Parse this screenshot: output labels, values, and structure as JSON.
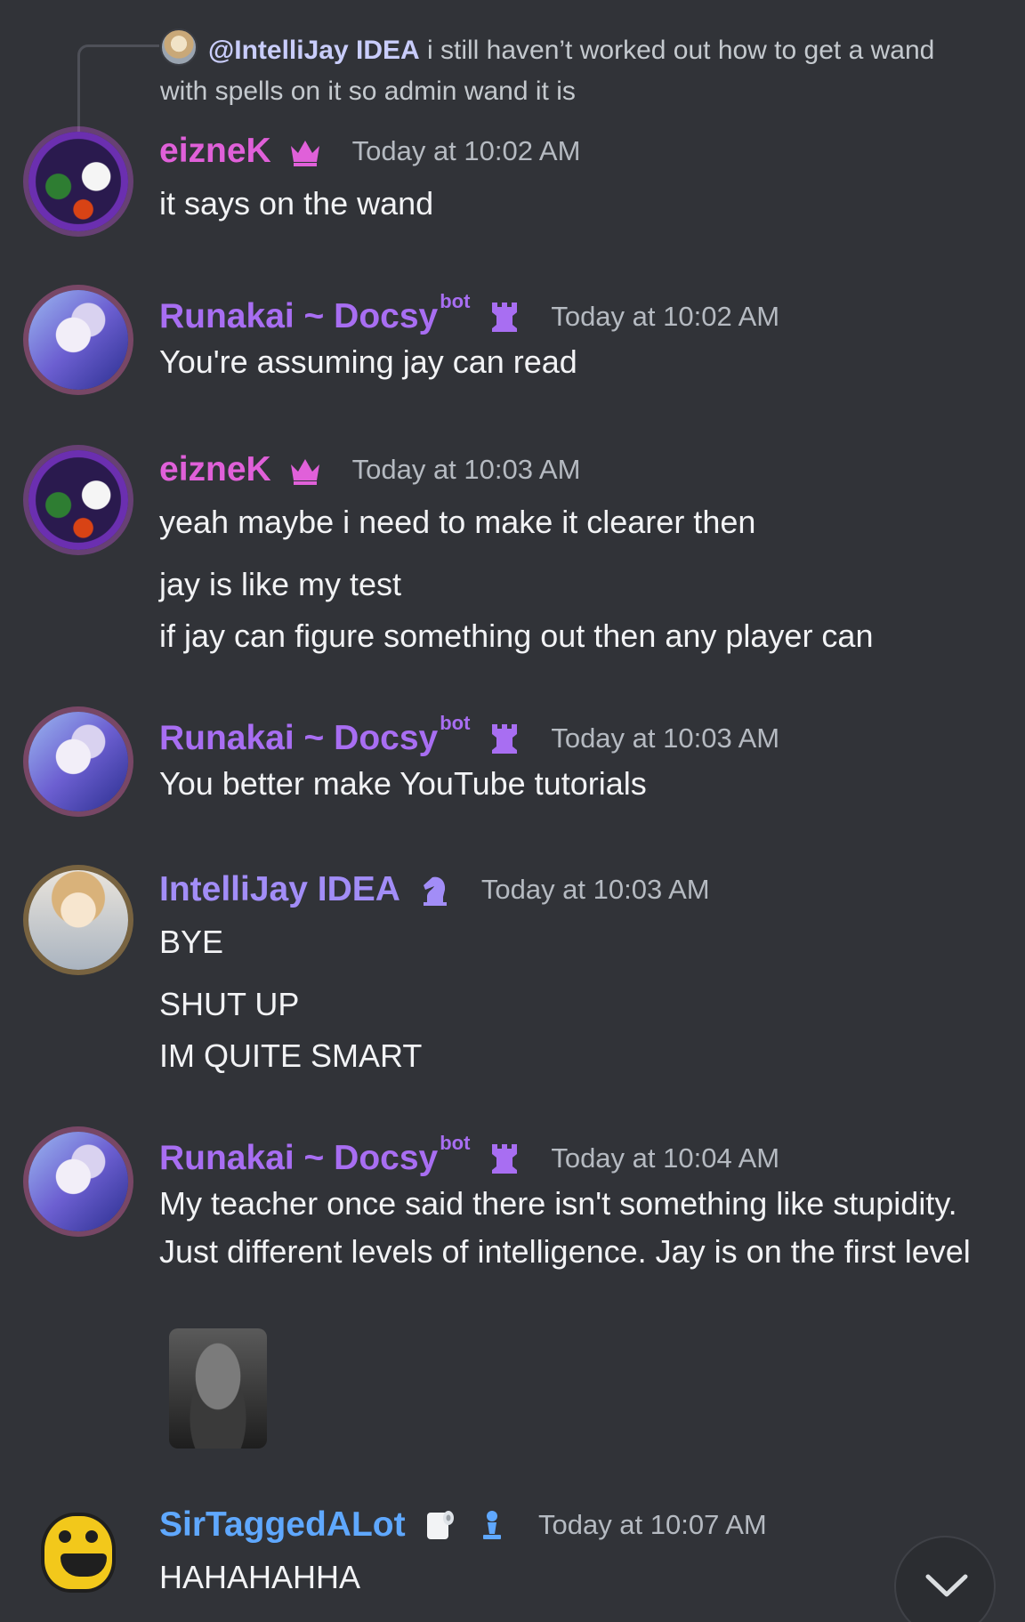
{
  "reply": {
    "mention": "@IntelliJay IDEA",
    "text": " i still haven’t worked out how to get a wand with spells on it so admin wand it is"
  },
  "messages": [
    {
      "author": "eizneK",
      "role_icon": "crown-icon",
      "timestamp": "Today at 10:02 AM",
      "lines": [
        "it says on the wand"
      ]
    },
    {
      "author": "Runakai ~ Docsy",
      "bot_tag": "bot",
      "role_icon": "rook-icon",
      "timestamp": "Today at 10:02 AM",
      "lines": [
        "You're assuming jay can read"
      ]
    },
    {
      "author": "eizneK",
      "role_icon": "crown-icon",
      "timestamp": "Today at 10:03 AM",
      "lines": [
        "yeah maybe i need to make it clearer then",
        "jay is like my test",
        "if jay can figure something out then any player can"
      ]
    },
    {
      "author": "Runakai ~ Docsy",
      "bot_tag": "bot",
      "role_icon": "rook-icon",
      "timestamp": "Today at 10:03 AM",
      "lines": [
        "You better make YouTube tutorials"
      ]
    },
    {
      "author": "IntelliJay IDEA",
      "role_icon": "knight-icon",
      "timestamp": "Today at 10:03 AM",
      "lines": [
        "BYE",
        "SHUT UP",
        "IM QUITE SMART"
      ]
    },
    {
      "author": "Runakai ~ Docsy",
      "bot_tag": "bot",
      "role_icon": "rook-icon",
      "timestamp": "Today at 10:04 AM",
      "lines": [
        "My teacher once said there isn't something like stupidity. Just different levels of intelligence. Jay is on the first level"
      ],
      "emoji_attachment": "gigachad-emoji"
    },
    {
      "author": "SirTaggedALot",
      "role_icons": [
        "toilet-paper-icon",
        "pawn-icon"
      ],
      "timestamp": "Today at 10:07 AM",
      "lines": [
        "HAHAHAHHA"
      ]
    }
  ],
  "colors": {
    "background": "#313338",
    "eizneK": "#e060d9",
    "Runakai": "#a86ef2",
    "IntelliJay": "#a28df7",
    "SirTaggedALot": "#5fa8ff",
    "timestamp": "#b5bac1"
  },
  "scroll_button_icon": "chevron-down-icon"
}
